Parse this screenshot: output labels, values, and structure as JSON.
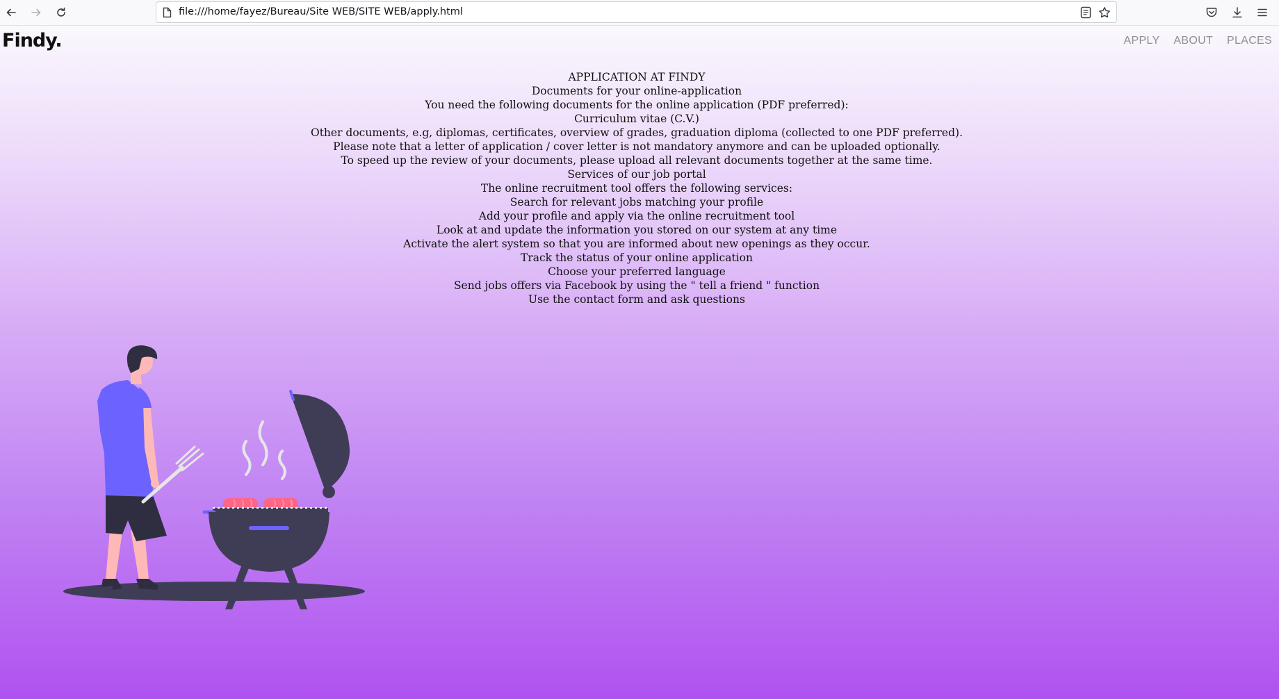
{
  "browser": {
    "url": "file:///home/fayez/Bureau/Site WEB/SITE WEB/apply.html"
  },
  "site": {
    "logo": "Findy.",
    "nav": [
      "APPLY",
      "ABOUT",
      "PLACES"
    ]
  },
  "content": {
    "lines": [
      "APPLICATION AT FINDY",
      "Documents for your online-application",
      "You need the following documents for the online application (PDF preferred):",
      "Curriculum vitae (C.V.)",
      "Other documents, e.g, diplomas, certificates, overview of grades, graduation diploma (collected to one PDF preferred).",
      "Please note that a letter of application / cover letter is not mandatory anymore and can be uploaded optionally.",
      "To speed up the review of your documents, please upload all relevant documents together at the same time.",
      "Services of our job portal",
      "The online recruitment tool offers the following services:",
      "Search for relevant jobs matching your profile",
      "Add your profile and apply via the online recruitment tool",
      "Look at and update the information you stored on our system at any time",
      "Activate the alert system so that you are informed about new openings as they occur.",
      "Track the status of your online application",
      "Choose your preferred language",
      "Send jobs offers via Facebook by using the \" tell a friend \" function",
      "Use the contact form and ask questions"
    ]
  },
  "colors": {
    "gradient_top": "#fbf8fd",
    "gradient_bottom": "#b052f0",
    "shirt": "#6c63ff",
    "grill": "#3f3d56",
    "skin": "#ffb8b8",
    "sausage": "#ff6584"
  },
  "icons": [
    "back-arrow-icon",
    "forward-arrow-icon",
    "reload-icon",
    "page-icon",
    "reader-view-icon",
    "bookmark-star-icon",
    "pocket-icon",
    "download-icon",
    "menu-icon"
  ]
}
